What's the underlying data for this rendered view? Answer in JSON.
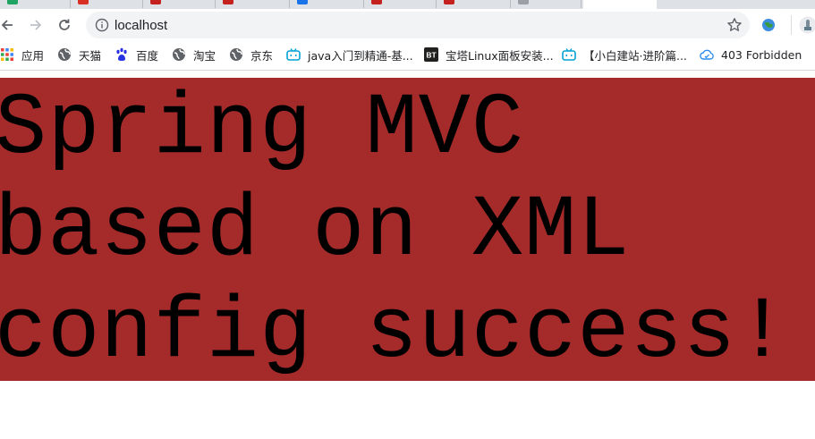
{
  "browser": {
    "address_bar": {
      "url": "localhost"
    },
    "bookmarks": [
      {
        "label": "应用",
        "icon": "apps-grid-icon"
      },
      {
        "label": "天猫",
        "icon": "globe-icon"
      },
      {
        "label": "百度",
        "icon": "baidu-paw-icon"
      },
      {
        "label": "淘宝",
        "icon": "globe-icon"
      },
      {
        "label": "京东",
        "icon": "globe-icon"
      },
      {
        "label": "java入门到精通-基...",
        "icon": "bilibili-tv-icon"
      },
      {
        "label": "宝塔Linux面板安装...",
        "icon": "bt-logo-icon"
      },
      {
        "label": "【小白建站·进阶篇...",
        "icon": "bilibili-tv-icon"
      },
      {
        "label": "403 Forbidden",
        "icon": "cloud-icon"
      }
    ]
  },
  "page": {
    "heading_lines": [
      "Spring MVC",
      "based on XML",
      "config success!"
    ],
    "banner_color": "#a52a2a"
  }
}
